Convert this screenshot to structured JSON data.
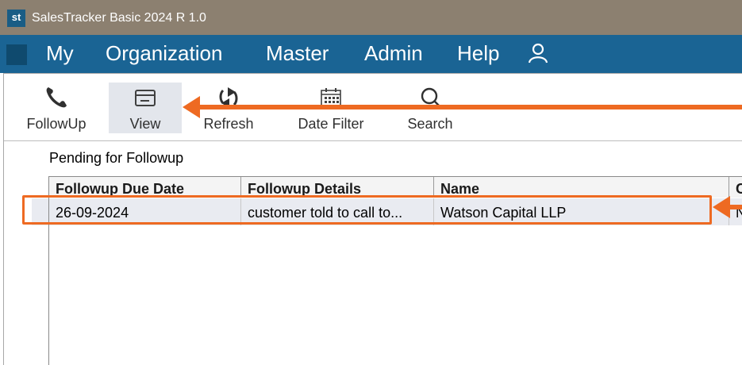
{
  "window": {
    "logo": "st",
    "title": "SalesTracker Basic 2024 R 1.0"
  },
  "menu": {
    "items": [
      "My",
      "Organization",
      "Master",
      "Admin",
      "Help"
    ]
  },
  "toolbar": {
    "followup": "FollowUp",
    "view": "View",
    "refresh": "Refresh",
    "date_filter": "Date Filter",
    "search": "Search"
  },
  "section": {
    "title": "Pending for Followup"
  },
  "grid": {
    "columns": [
      "Followup Due Date",
      "Followup Details",
      "Name",
      "C"
    ],
    "rows": [
      {
        "due_date": "26-09-2024",
        "details": "customer told to call to...",
        "name": "Watson Capital LLP",
        "c": "N"
      }
    ]
  },
  "colors": {
    "menu_bg": "#1a6494",
    "title_bg": "#8c8070",
    "annotation": "#ee6a22",
    "selected_row": "#e9ebf1"
  }
}
